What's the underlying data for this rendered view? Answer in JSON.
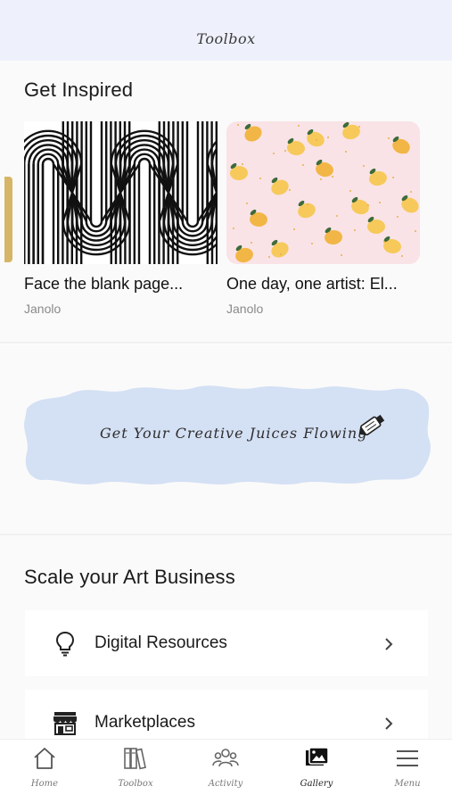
{
  "header": {
    "title": "Toolbox"
  },
  "inspired": {
    "title": "Get Inspired",
    "cards": [
      {
        "title": "Face the blank page...",
        "author": "Janolo"
      },
      {
        "title": "One day, one artist: El...",
        "author": "Janolo"
      }
    ]
  },
  "banner": {
    "text": "Get Your Creative Juices Flowing",
    "icon": "paint-tube-icon"
  },
  "business": {
    "title": "Scale your Art Business",
    "items": [
      {
        "label": "Digital Resources",
        "icon": "lightbulb-icon"
      },
      {
        "label": "Marketplaces",
        "icon": "storefront-icon"
      }
    ]
  },
  "nav": {
    "items": [
      {
        "label": "Home",
        "icon": "home-icon"
      },
      {
        "label": "Toolbox",
        "icon": "books-icon"
      },
      {
        "label": "Activity",
        "icon": "people-icon"
      },
      {
        "label": "Gallery",
        "icon": "gallery-icon"
      },
      {
        "label": "Menu",
        "icon": "menu-icon"
      }
    ]
  },
  "colors": {
    "header_bg": "#eef1fb",
    "banner_bg": "#d4e0f4",
    "lemon_pattern_bg": "#f9e3e6",
    "accent_tab": "#d7b567"
  }
}
